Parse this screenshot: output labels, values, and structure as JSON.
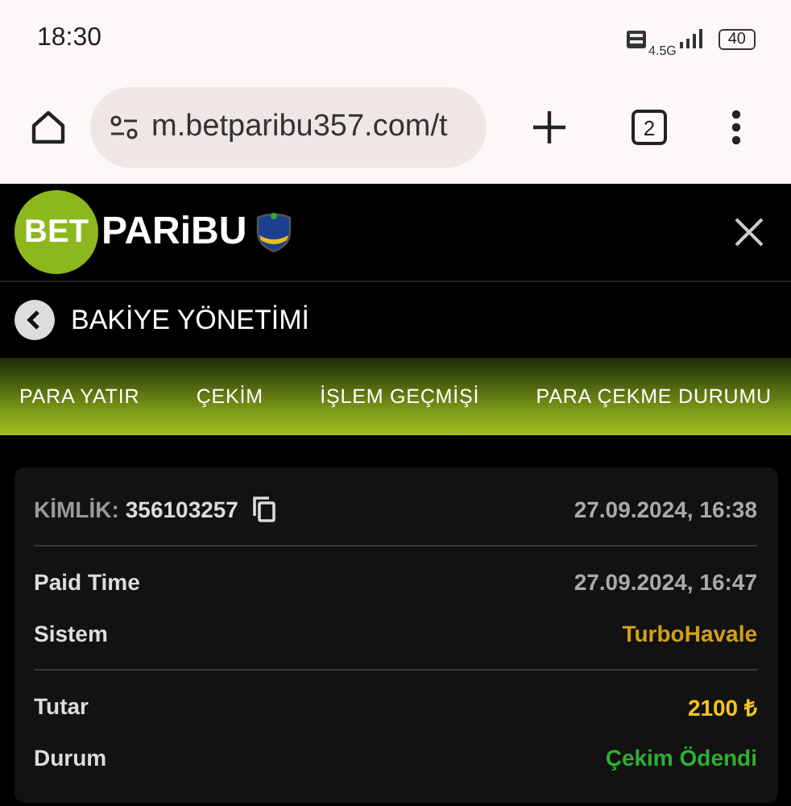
{
  "status_bar": {
    "time": "18:30",
    "network": "4.5G",
    "battery": "40"
  },
  "browser": {
    "url": "m.betparibu357.com/t",
    "tab_count": "2"
  },
  "header": {
    "logo_badge": "BET",
    "logo_text": "PARiBU"
  },
  "page_title": "BAKİYE YÖNETİMİ",
  "tabs": [
    {
      "label": "PARA YATIR"
    },
    {
      "label": "ÇEKİM"
    },
    {
      "label": "İŞLEM GEÇMİŞİ"
    },
    {
      "label": "PARA ÇEKME DURUMU"
    }
  ],
  "card": {
    "id_label": "KİMLİK:",
    "id_value": "356103257",
    "created": "27.09.2024, 16:38",
    "sections": [
      [
        {
          "label": "Paid Time",
          "value": "27.09.2024, 16:47",
          "kind": "plain"
        },
        {
          "label": "Sistem",
          "value": "TurboHavale",
          "kind": "system"
        }
      ],
      [
        {
          "label": "Tutar",
          "value": "2100 ₺",
          "kind": "amount"
        },
        {
          "label": "Durum",
          "value": "Çekim Ödendi",
          "kind": "status"
        }
      ]
    ]
  }
}
